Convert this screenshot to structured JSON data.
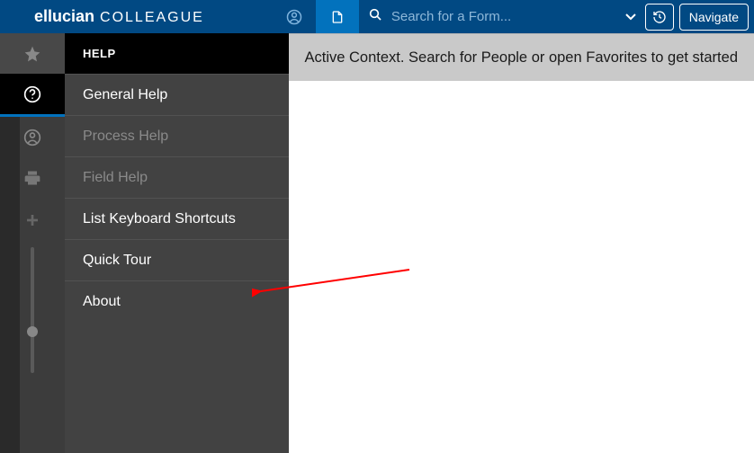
{
  "header": {
    "brand_bold": "ellucian",
    "brand_light": "COLLEAGUE",
    "search_placeholder": "Search for a Form...",
    "navigate_label": "Navigate"
  },
  "panel": {
    "title": "HELP",
    "items": [
      {
        "label": "General Help",
        "disabled": false
      },
      {
        "label": "Process Help",
        "disabled": true
      },
      {
        "label": "Field Help",
        "disabled": true
      },
      {
        "label": "List Keyboard Shortcuts",
        "disabled": false
      },
      {
        "label": "Quick Tour",
        "disabled": false
      },
      {
        "label": "About",
        "disabled": false
      }
    ]
  },
  "content": {
    "context_message": "Active Context. Search for People or open Favorites to get started"
  }
}
